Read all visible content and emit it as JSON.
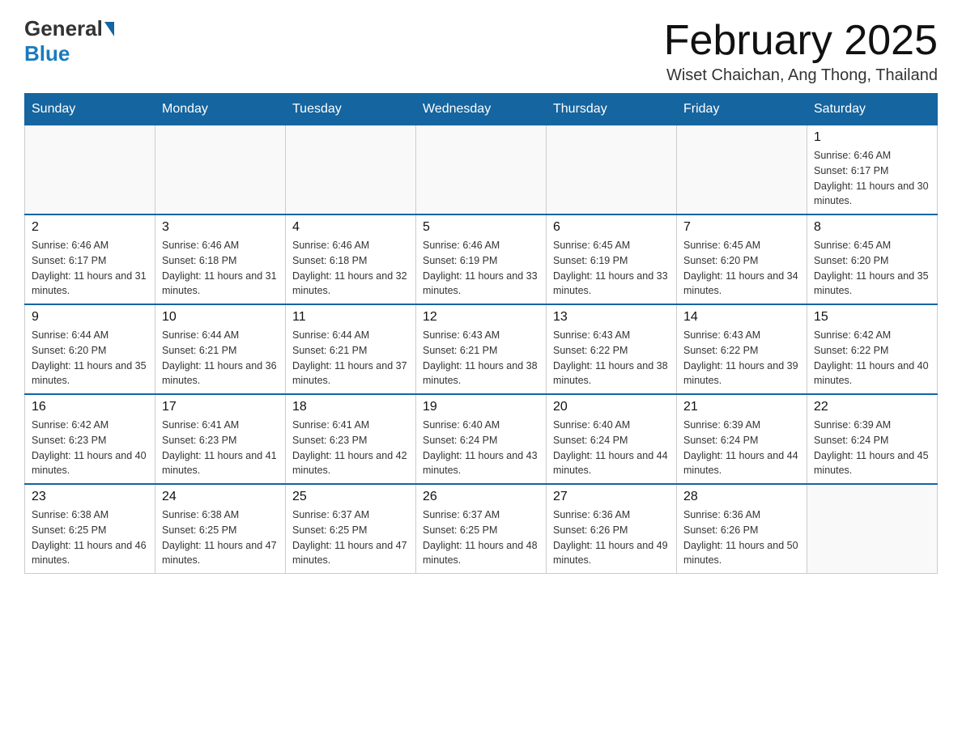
{
  "header": {
    "logo_general": "General",
    "logo_blue": "Blue",
    "month_title": "February 2025",
    "subtitle": "Wiset Chaichan, Ang Thong, Thailand"
  },
  "weekdays": [
    "Sunday",
    "Monday",
    "Tuesday",
    "Wednesday",
    "Thursday",
    "Friday",
    "Saturday"
  ],
  "weeks": [
    [
      {
        "day": "",
        "info": ""
      },
      {
        "day": "",
        "info": ""
      },
      {
        "day": "",
        "info": ""
      },
      {
        "day": "",
        "info": ""
      },
      {
        "day": "",
        "info": ""
      },
      {
        "day": "",
        "info": ""
      },
      {
        "day": "1",
        "info": "Sunrise: 6:46 AM\nSunset: 6:17 PM\nDaylight: 11 hours and 30 minutes."
      }
    ],
    [
      {
        "day": "2",
        "info": "Sunrise: 6:46 AM\nSunset: 6:17 PM\nDaylight: 11 hours and 31 minutes."
      },
      {
        "day": "3",
        "info": "Sunrise: 6:46 AM\nSunset: 6:18 PM\nDaylight: 11 hours and 31 minutes."
      },
      {
        "day": "4",
        "info": "Sunrise: 6:46 AM\nSunset: 6:18 PM\nDaylight: 11 hours and 32 minutes."
      },
      {
        "day": "5",
        "info": "Sunrise: 6:46 AM\nSunset: 6:19 PM\nDaylight: 11 hours and 33 minutes."
      },
      {
        "day": "6",
        "info": "Sunrise: 6:45 AM\nSunset: 6:19 PM\nDaylight: 11 hours and 33 minutes."
      },
      {
        "day": "7",
        "info": "Sunrise: 6:45 AM\nSunset: 6:20 PM\nDaylight: 11 hours and 34 minutes."
      },
      {
        "day": "8",
        "info": "Sunrise: 6:45 AM\nSunset: 6:20 PM\nDaylight: 11 hours and 35 minutes."
      }
    ],
    [
      {
        "day": "9",
        "info": "Sunrise: 6:44 AM\nSunset: 6:20 PM\nDaylight: 11 hours and 35 minutes."
      },
      {
        "day": "10",
        "info": "Sunrise: 6:44 AM\nSunset: 6:21 PM\nDaylight: 11 hours and 36 minutes."
      },
      {
        "day": "11",
        "info": "Sunrise: 6:44 AM\nSunset: 6:21 PM\nDaylight: 11 hours and 37 minutes."
      },
      {
        "day": "12",
        "info": "Sunrise: 6:43 AM\nSunset: 6:21 PM\nDaylight: 11 hours and 38 minutes."
      },
      {
        "day": "13",
        "info": "Sunrise: 6:43 AM\nSunset: 6:22 PM\nDaylight: 11 hours and 38 minutes."
      },
      {
        "day": "14",
        "info": "Sunrise: 6:43 AM\nSunset: 6:22 PM\nDaylight: 11 hours and 39 minutes."
      },
      {
        "day": "15",
        "info": "Sunrise: 6:42 AM\nSunset: 6:22 PM\nDaylight: 11 hours and 40 minutes."
      }
    ],
    [
      {
        "day": "16",
        "info": "Sunrise: 6:42 AM\nSunset: 6:23 PM\nDaylight: 11 hours and 40 minutes."
      },
      {
        "day": "17",
        "info": "Sunrise: 6:41 AM\nSunset: 6:23 PM\nDaylight: 11 hours and 41 minutes."
      },
      {
        "day": "18",
        "info": "Sunrise: 6:41 AM\nSunset: 6:23 PM\nDaylight: 11 hours and 42 minutes."
      },
      {
        "day": "19",
        "info": "Sunrise: 6:40 AM\nSunset: 6:24 PM\nDaylight: 11 hours and 43 minutes."
      },
      {
        "day": "20",
        "info": "Sunrise: 6:40 AM\nSunset: 6:24 PM\nDaylight: 11 hours and 44 minutes."
      },
      {
        "day": "21",
        "info": "Sunrise: 6:39 AM\nSunset: 6:24 PM\nDaylight: 11 hours and 44 minutes."
      },
      {
        "day": "22",
        "info": "Sunrise: 6:39 AM\nSunset: 6:24 PM\nDaylight: 11 hours and 45 minutes."
      }
    ],
    [
      {
        "day": "23",
        "info": "Sunrise: 6:38 AM\nSunset: 6:25 PM\nDaylight: 11 hours and 46 minutes."
      },
      {
        "day": "24",
        "info": "Sunrise: 6:38 AM\nSunset: 6:25 PM\nDaylight: 11 hours and 47 minutes."
      },
      {
        "day": "25",
        "info": "Sunrise: 6:37 AM\nSunset: 6:25 PM\nDaylight: 11 hours and 47 minutes."
      },
      {
        "day": "26",
        "info": "Sunrise: 6:37 AM\nSunset: 6:25 PM\nDaylight: 11 hours and 48 minutes."
      },
      {
        "day": "27",
        "info": "Sunrise: 6:36 AM\nSunset: 6:26 PM\nDaylight: 11 hours and 49 minutes."
      },
      {
        "day": "28",
        "info": "Sunrise: 6:36 AM\nSunset: 6:26 PM\nDaylight: 11 hours and 50 minutes."
      },
      {
        "day": "",
        "info": ""
      }
    ]
  ]
}
